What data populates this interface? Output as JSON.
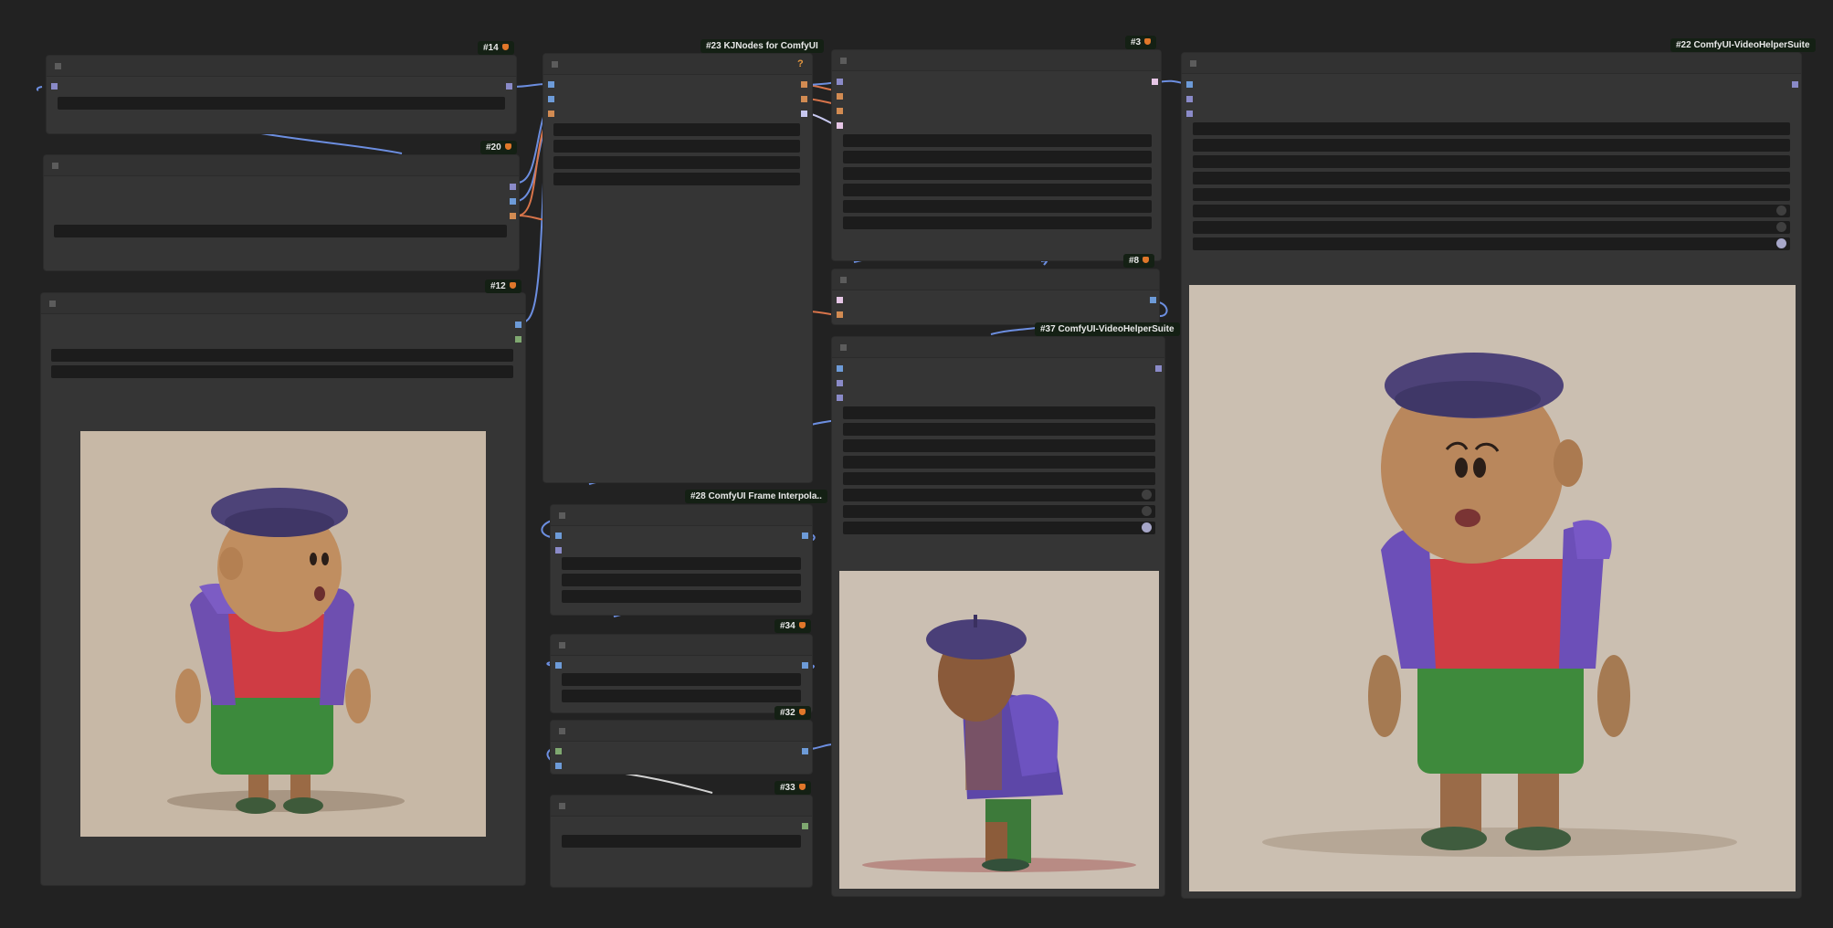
{
  "canvas": {
    "background": "#222222"
  },
  "colors": {
    "wire_blue": "#6c8ee0",
    "wire_orange": "#d8744a",
    "slot_blue": "#6d9bd8",
    "slot_orange": "#d28b52",
    "slot_pink": "#e6c6e6",
    "slot_green": "#7fa870",
    "slot_lavender": "#8a8ac8"
  },
  "nodes": {
    "n14": {
      "badge": "#14"
    },
    "n20": {
      "badge": "#20"
    },
    "n12": {
      "badge": "#12",
      "preview": "toon-character-front-view"
    },
    "n23": {
      "badge": "#23 KJNodes for ComfyUI",
      "help_mark": "?"
    },
    "n28": {
      "badge": "#28 ComfyUI Frame Interpola.."
    },
    "n34": {
      "badge": "#34"
    },
    "n32": {
      "badge": "#32"
    },
    "n33": {
      "badge": "#33"
    },
    "n3": {
      "badge": "#3"
    },
    "n8": {
      "badge": "#8"
    },
    "n37": {
      "badge": "#37 ComfyUI-VideoHelperSuite",
      "preview": "toon-character-side-view"
    },
    "n22": {
      "badge": "#22 ComfyUI-VideoHelperSuite",
      "preview": "toon-character-video-frame"
    }
  },
  "icons": {
    "collapse": "collapse-toggle-icon",
    "badge": "fox-badge-icon",
    "help": "help-icon"
  }
}
